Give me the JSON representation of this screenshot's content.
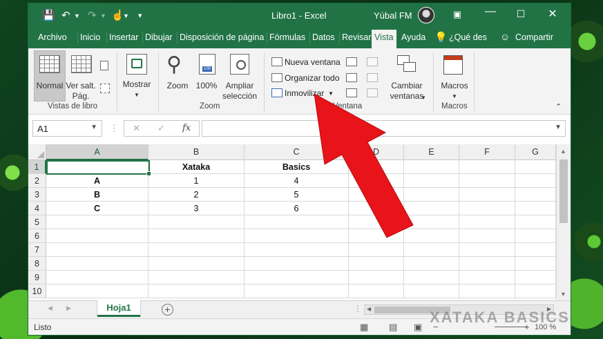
{
  "window": {
    "title": "Libro1  -  Excel",
    "user": "Yúbal FM"
  },
  "tabs": [
    "Archivo",
    "Inicio",
    "Insertar",
    "Dibujar",
    "Disposición de página",
    "Fórmulas",
    "Datos",
    "Revisar",
    "Vista",
    "Ayuda",
    "¿Qué des",
    "Compartir"
  ],
  "active_tab": "Vista",
  "ribbon": {
    "vistas": {
      "normal": "Normal",
      "ver_salt_1": "Ver salt.",
      "ver_salt_2": "Pág.",
      "group": "Vistas de libro"
    },
    "mostrar": "Mostrar",
    "zoom": {
      "zoom": "Zoom",
      "pct": "100%",
      "ampliar_1": "Ampliar",
      "ampliar_2": "selección",
      "group": "Zoom"
    },
    "ventana": {
      "nueva": "Nueva ventana",
      "organizar": "Organizar todo",
      "inmovilizar": "Inmovilizar",
      "cambiar_1": "Cambiar",
      "cambiar_2": "ventanas",
      "group": "Ventana"
    },
    "macros": {
      "macros": "Macros",
      "group": "Macros"
    }
  },
  "formula_bar": {
    "name_box": "A1",
    "fx": "fx",
    "content": ""
  },
  "sheet": {
    "columns": [
      "A",
      "B",
      "C",
      "D",
      "E",
      "F",
      "G"
    ],
    "rows": [
      "1",
      "2",
      "3",
      "4",
      "5",
      "6",
      "7",
      "8",
      "9",
      "10"
    ],
    "cells": [
      [
        "",
        "Xataka",
        "Basics",
        "",
        "",
        "",
        ""
      ],
      [
        "A",
        "1",
        "4",
        "",
        "",
        "",
        ""
      ],
      [
        "B",
        "2",
        "5",
        "",
        "",
        "",
        ""
      ],
      [
        "C",
        "3",
        "6",
        "",
        "",
        "",
        ""
      ]
    ],
    "active_cell": "A1"
  },
  "sheet_tabs": [
    "Hoja1"
  ],
  "status": {
    "text": "Listo",
    "zoom": "100 %"
  },
  "watermark": "XATAKA BASICS",
  "colors": {
    "excel_green": "#217346",
    "arrow_red": "#e8141a"
  }
}
